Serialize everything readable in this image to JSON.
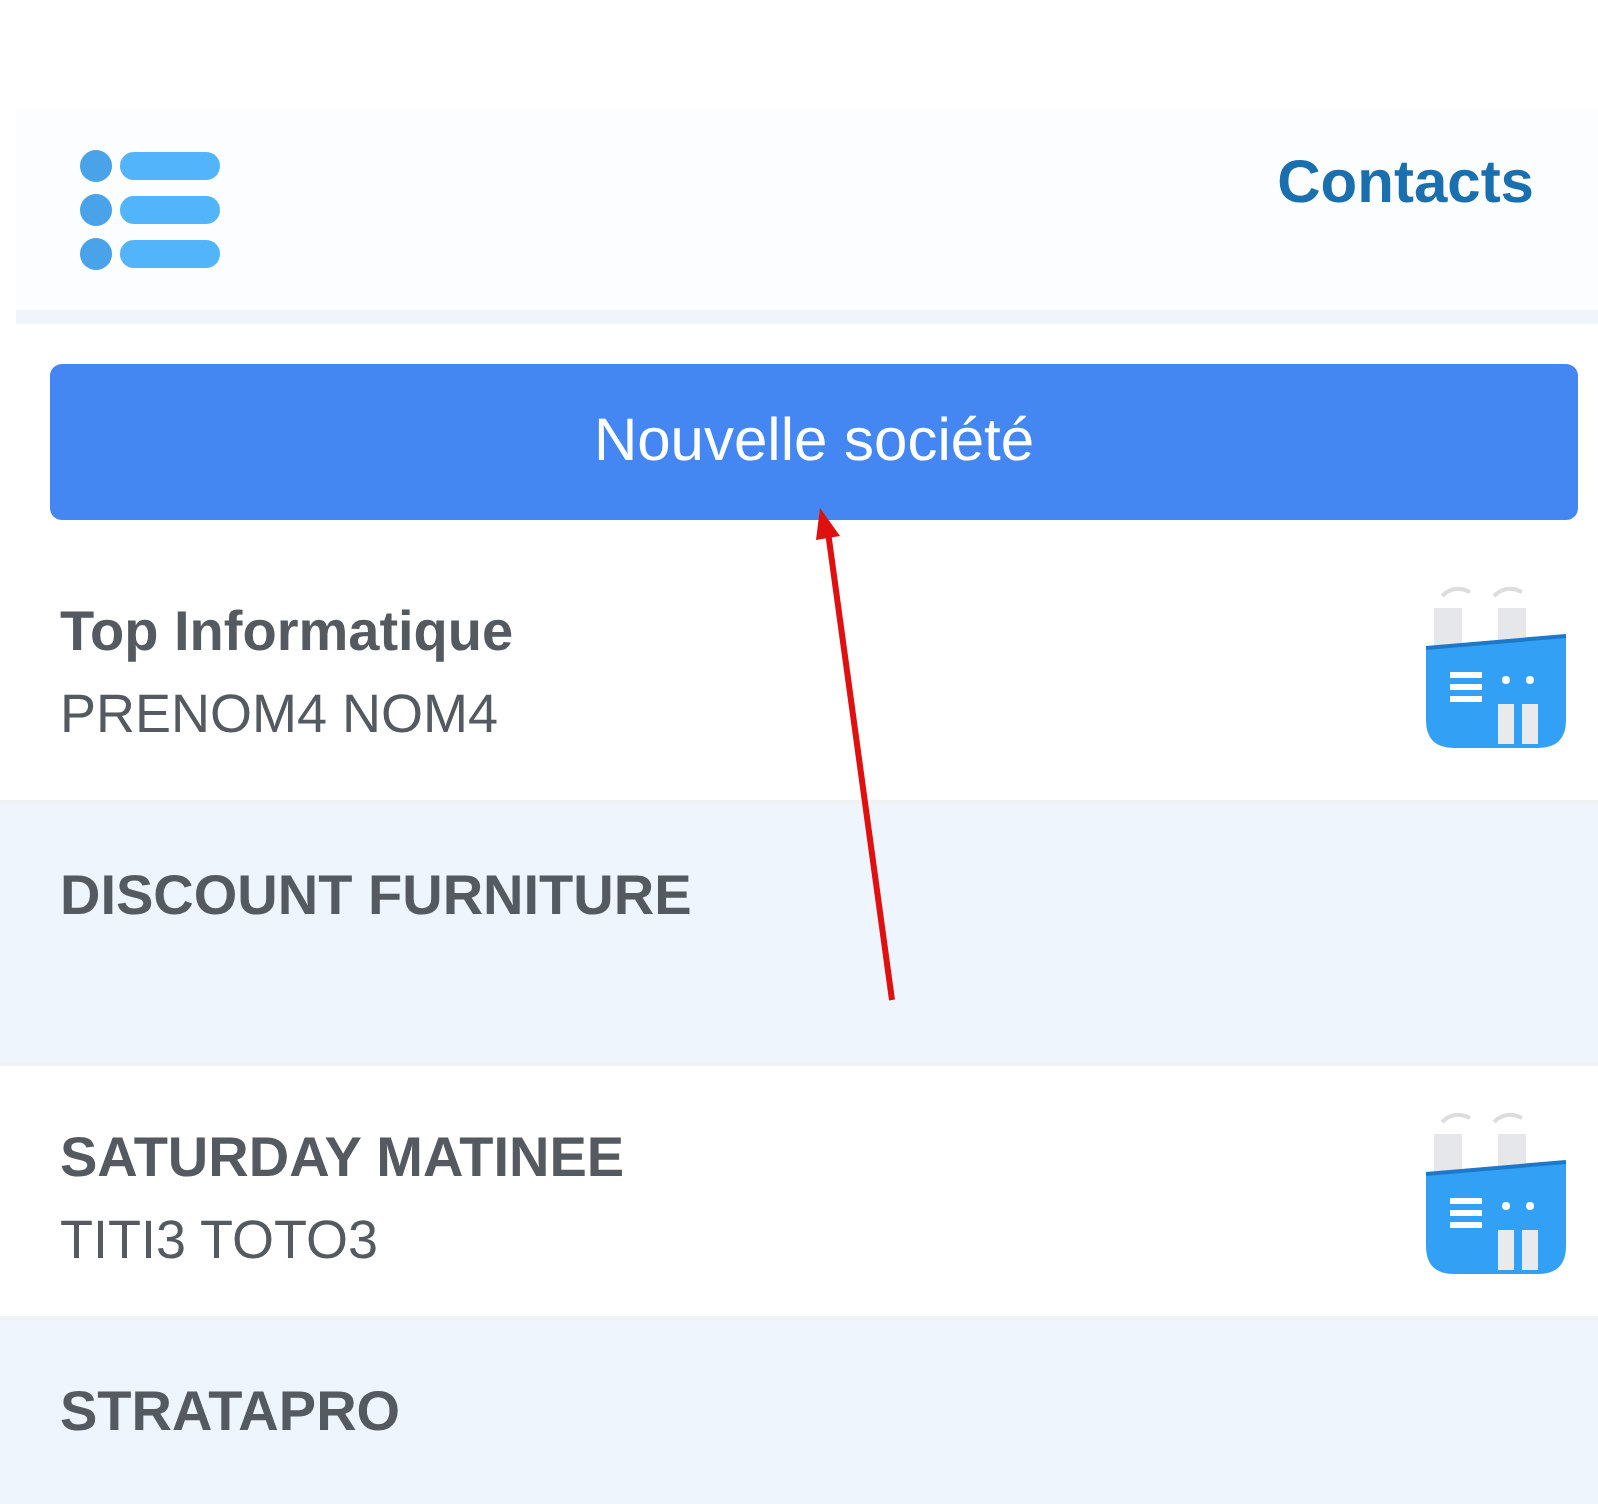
{
  "header": {
    "title": "Contacts"
  },
  "new_button": {
    "label": "Nouvelle société"
  },
  "companies": [
    {
      "name": "Top Informatique",
      "contact": "PRENOM4 NOM4",
      "icon": true
    },
    {
      "name": "DISCOUNT FURNITURE",
      "icon": false
    },
    {
      "name": "SATURDAY MATINEE",
      "contact": "TITI3 TOTO3",
      "icon": true
    },
    {
      "name": "STRATAPRO",
      "icon": false
    }
  ]
}
